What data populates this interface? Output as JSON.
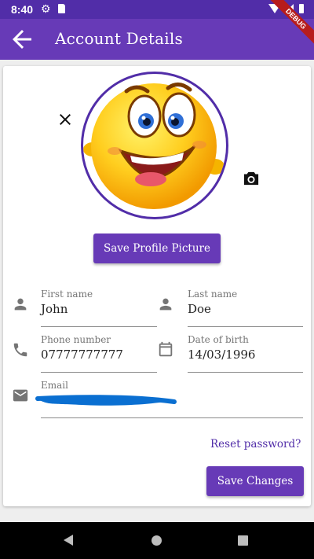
{
  "status_bar": {
    "time": "8:40"
  },
  "app_bar": {
    "title": "Account Details",
    "debug_banner": "DEBUG"
  },
  "profile": {
    "save_picture_label": "Save Profile Picture"
  },
  "form": {
    "first_name": {
      "label": "First name",
      "value": "John"
    },
    "last_name": {
      "label": "Last name",
      "value": "Doe"
    },
    "phone": {
      "label": "Phone number",
      "value": "07777777777"
    },
    "dob": {
      "label": "Date of birth",
      "value": "14/03/1996"
    },
    "email": {
      "label": "Email",
      "value": ""
    }
  },
  "reset_password_label": "Reset password?",
  "save_changes_label": "Save Changes",
  "colors": {
    "primary": "#673ab7",
    "primary_dark": "#512da8",
    "scribble": "#0a6fd1"
  },
  "icons": [
    "arrow-back-icon",
    "close-icon",
    "camera-icon",
    "person-icon",
    "phone-icon",
    "calendar-icon",
    "mail-icon"
  ]
}
